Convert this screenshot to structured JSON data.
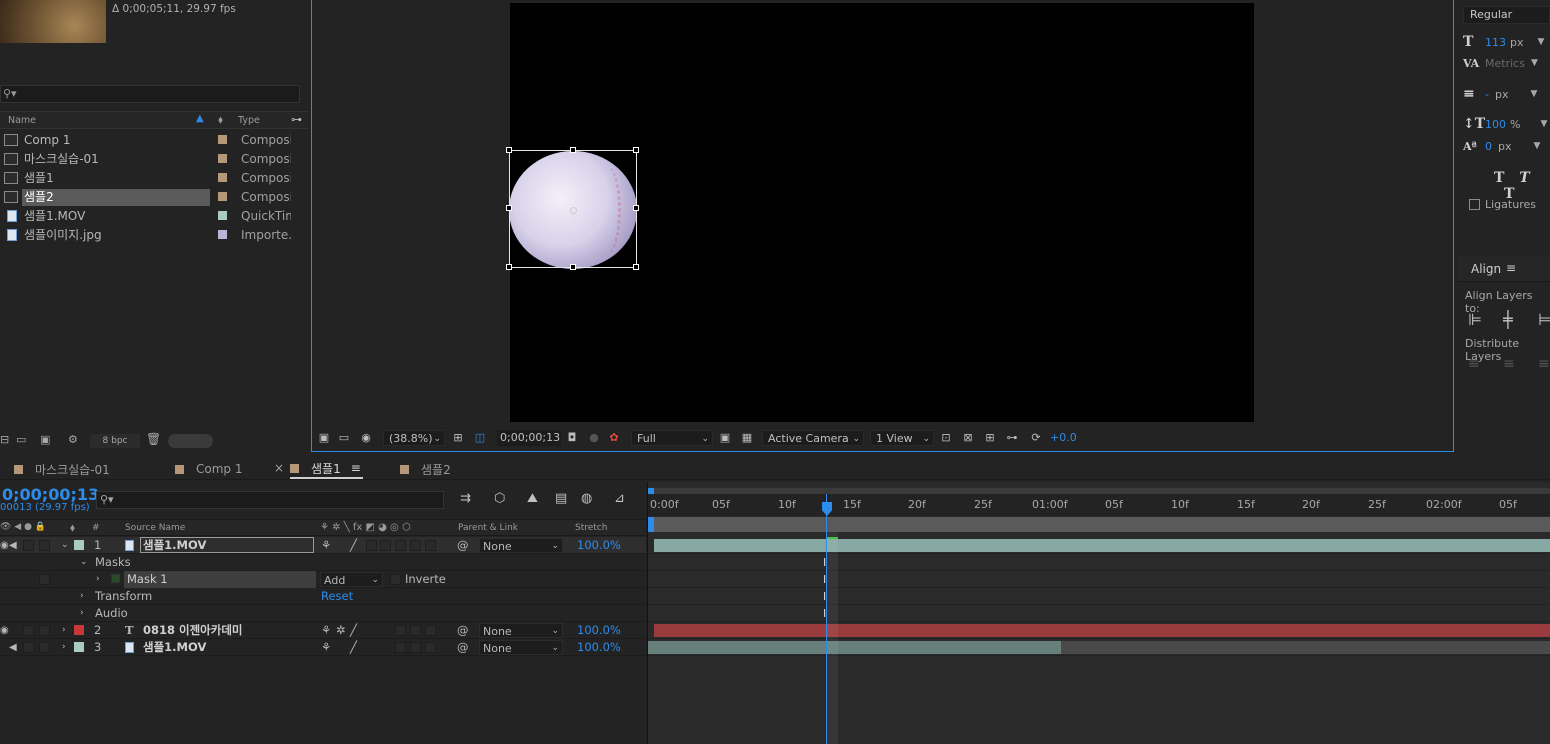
{
  "project": {
    "info_line": "Δ 0;00;05;11, 29.97 fps",
    "search_placeholder": "",
    "columns": {
      "name": "Name",
      "type": "Type"
    },
    "items": [
      {
        "name": "Comp 1",
        "type": "Composi",
        "kind": "comp",
        "color": "#b5977a"
      },
      {
        "name": "마스크실습-01",
        "type": "Composi",
        "kind": "comp",
        "color": "#b5977a"
      },
      {
        "name": "샘플1",
        "type": "Composi",
        "kind": "comp",
        "color": "#b5977a"
      },
      {
        "name": "샘플2",
        "type": "Composi",
        "kind": "comp",
        "color": "#b5977a",
        "selected": true
      },
      {
        "name": "샘플1.MOV",
        "type": "QuickTim",
        "kind": "file",
        "color": "#a9cbc4"
      },
      {
        "name": "샘플이미지.jpg",
        "type": "Importe..",
        "kind": "file",
        "color": "#b7b4d8"
      }
    ],
    "bpc": "8 bpc"
  },
  "viewer": {
    "zoom": "(38.8%)",
    "timecode": "0;00;00;13",
    "resolution": "Full",
    "camera": "Active Camera",
    "views": "1 View",
    "exposure": "+0.0"
  },
  "character": {
    "font_style": "Regular",
    "font_size": "113",
    "font_size_unit": "px",
    "kerning": "Metrics",
    "leading": "-",
    "leading_unit": "px",
    "vert_scale": "100",
    "vert_scale_unit": "%",
    "baseline": "0",
    "baseline_unit": "px",
    "ligatures": "Ligatures",
    "style_buttons": [
      "T",
      "T",
      "T"
    ]
  },
  "align": {
    "title": "Align",
    "align_to": "Align Layers to:",
    "distribute": "Distribute Layers"
  },
  "timeline_tabs": [
    {
      "label": "마스크실습-01",
      "color": "#b5977a"
    },
    {
      "label": "Comp 1",
      "color": "#b5977a"
    },
    {
      "label": "샘플1",
      "color": "#b5977a",
      "active": true
    },
    {
      "label": "샘플2",
      "color": "#b5977a"
    }
  ],
  "timeline": {
    "timecode": "0;00;00;13",
    "frames": "00013 (29.97 fps)",
    "headers": {
      "num": "#",
      "source": "Source Name",
      "parent": "Parent & Link",
      "stretch": "Stretch"
    },
    "layers": [
      {
        "num": "1",
        "name": "샘플1.MOV",
        "color": "#a9cbc4",
        "parent": "None",
        "stretch": "100.0%",
        "type": "file"
      },
      {
        "num": "2",
        "name": "0818 이젠아카데미",
        "color": "#c8383a",
        "parent": "None",
        "stretch": "100.0%",
        "type": "text"
      },
      {
        "num": "3",
        "name": "샘플1.MOV",
        "color": "#a9cbc4",
        "parent": "None",
        "stretch": "100.0%",
        "type": "file"
      }
    ],
    "masks_label": "Masks",
    "mask1": "Mask 1",
    "mask_mode": "Add",
    "inverted": "Inverte",
    "transform": "Transform",
    "reset": "Reset",
    "audio": "Audio",
    "ruler_ticks": [
      "0:00f",
      "05f",
      "10f",
      "15f",
      "20f",
      "25f",
      "01:00f",
      "05f",
      "10f",
      "15f",
      "20f",
      "25f",
      "02:00f",
      "05f"
    ]
  }
}
